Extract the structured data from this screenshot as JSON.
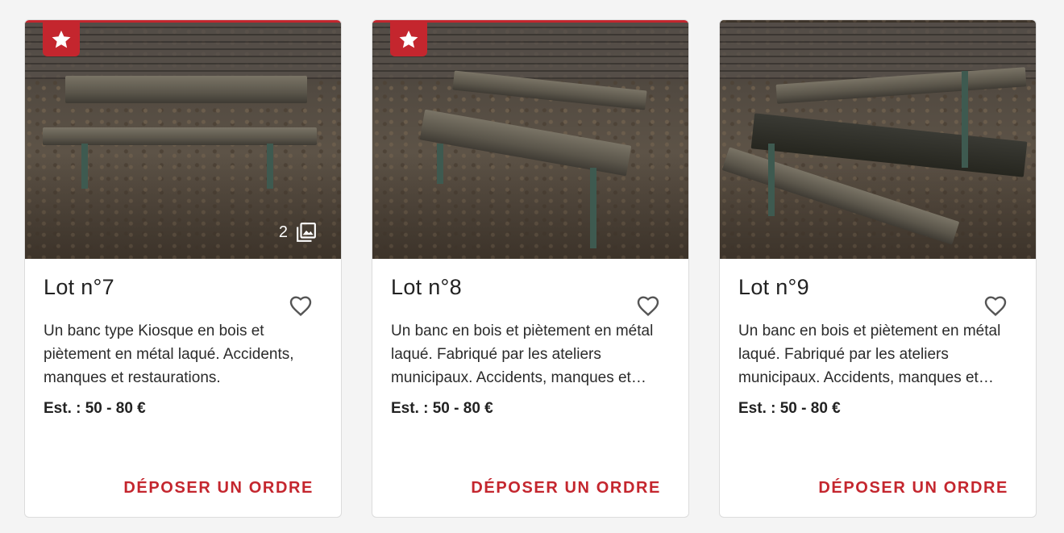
{
  "lots": [
    {
      "title": "Lot n°7",
      "description": "Un banc type Kiosque en bois et piètement en métal laqué. Accidents, manques et restaurations.",
      "estimate": "Est. : 50 - 80 €",
      "photo_count": "2",
      "order_label": "DÉPOSER UN ORDRE",
      "featured": true
    },
    {
      "title": "Lot n°8",
      "description": "Un banc en bois et piètement en métal laqué. Fabriqué par les ateliers municipaux. Accidents, manques et restaurations.",
      "estimate": "Est. : 50 - 80 €",
      "order_label": "DÉPOSER UN ORDRE",
      "featured": true
    },
    {
      "title": "Lot n°9",
      "description": "Un banc en bois et piètement en métal laqué. Fabriqué par les ateliers municipaux. Accidents, manques et restaurations.",
      "estimate": "Est. : 50 - 80 €",
      "order_label": "DÉPOSER UN ORDRE",
      "featured": false
    }
  ],
  "colors": {
    "accent": "#c4262e",
    "card_bg": "#ffffff",
    "page_bg": "#f4f4f4"
  },
  "icons": {
    "featured": "star-icon",
    "photos": "image-stack-icon",
    "favorite": "heart-outline-icon"
  }
}
